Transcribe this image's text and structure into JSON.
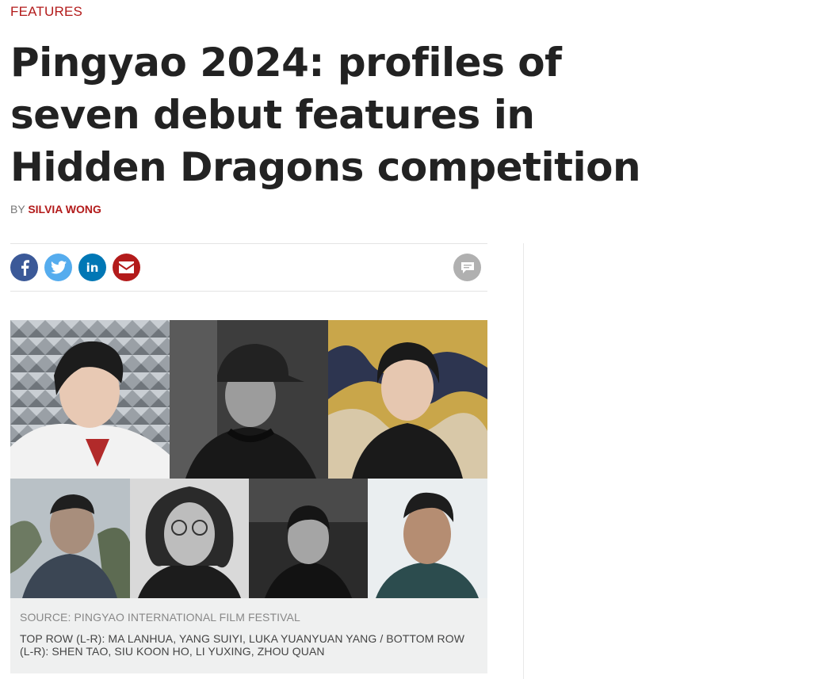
{
  "article": {
    "section": "FEATURES",
    "title": "Pingyao 2024: profiles of seven debut features in Hidden Dragons competition",
    "byline_prefix": "BY",
    "author": "SILVIA WONG"
  },
  "share": {
    "facebook_icon": "facebook-icon",
    "twitter_icon": "twitter-icon",
    "linkedin_icon": "linkedin-icon",
    "email_icon": "email-icon",
    "comments_icon": "comment-icon",
    "linkedin_text": "in",
    "colors": {
      "facebook": "#3b5998",
      "twitter": "#55acee",
      "linkedin": "#0077b5",
      "email": "#b31b1b",
      "comments": "#b0b0b0"
    }
  },
  "figure": {
    "source": "SOURCE: PINGYAO INTERNATIONAL FILM FESTIVAL",
    "caption": "TOP ROW (L-R): MA LANHUA, YANG SUIYI, LUKA YUANYUAN YANG / BOTTOM ROW (L-R): SHEN TAO, SIU KOON HO, LI YUXING, ZHOU QUAN"
  },
  "theme": {
    "accent": "#b31b1b"
  }
}
